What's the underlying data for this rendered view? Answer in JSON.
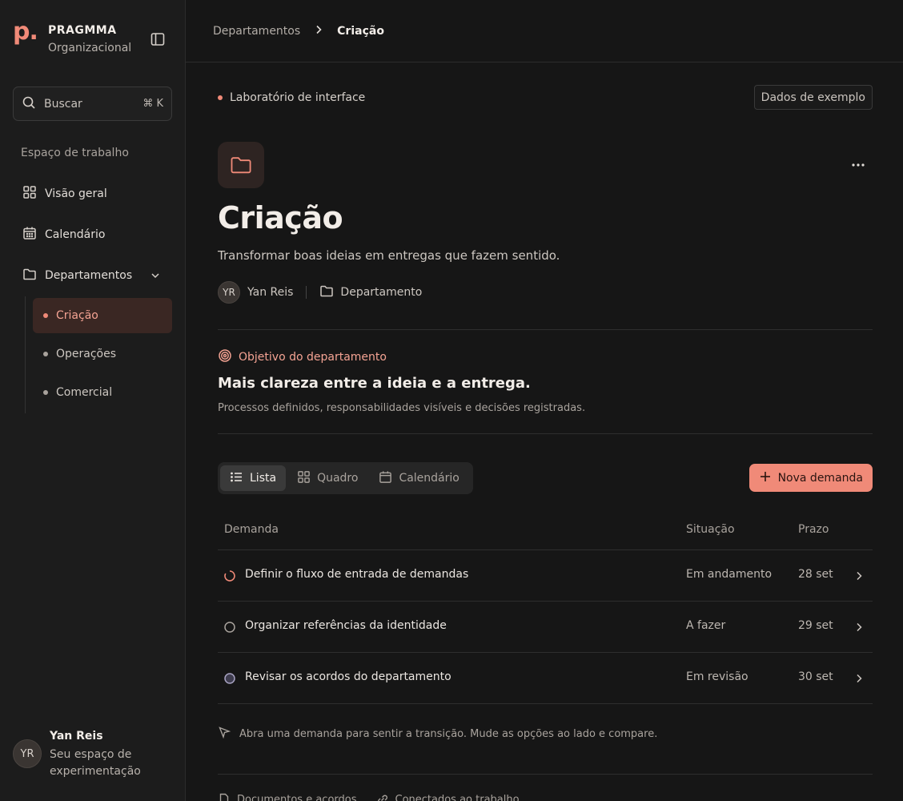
{
  "brand": {
    "logo": "p.",
    "name": "PRAGMMA",
    "subtitle": "Organizacional"
  },
  "search": {
    "label": "Buscar",
    "shortcut": "⌘ K"
  },
  "sidebar": {
    "section_label": "Espaço de trabalho",
    "items": [
      {
        "label": "Visão geral",
        "icon": "grid-icon"
      },
      {
        "label": "Calendário",
        "icon": "calendar-icon"
      },
      {
        "label": "Departamentos",
        "icon": "folder-icon"
      }
    ],
    "departments": [
      {
        "label": "Criação",
        "active": true
      },
      {
        "label": "Operações",
        "active": false
      },
      {
        "label": "Comercial",
        "active": false
      }
    ]
  },
  "user": {
    "initials": "YR",
    "name": "Yan Reis",
    "subtitle": "Seu espaço de experimentação"
  },
  "breadcrumb": {
    "parent": "Departamentos",
    "current": "Criação"
  },
  "header": {
    "lab_tag": "Laboratório de interface",
    "sample_button": "Dados de exemplo"
  },
  "department": {
    "title": "Criação",
    "description": "Transformar boas ideias em entregas que fazem sentido.",
    "owner_initials": "YR",
    "owner_name": "Yan Reis",
    "type": "Departamento"
  },
  "goal": {
    "label": "Objetivo do departamento",
    "title": "Mais clareza entre a ideia e a entrega.",
    "description": "Processos definidos, responsabilidades visíveis e decisões registradas."
  },
  "views": {
    "list": "Lista",
    "board": "Quadro",
    "calendar": "Calendário"
  },
  "new_button": "Nova demanda",
  "table": {
    "headers": {
      "demand": "Demanda",
      "status": "Situação",
      "due": "Prazo"
    },
    "rows": [
      {
        "title": "Definir o fluxo de entrada de demandas",
        "status": "Em andamento",
        "due": "28 set"
      },
      {
        "title": "Organizar referências da identidade",
        "status": "A fazer",
        "due": "29 set"
      },
      {
        "title": "Revisar os acordos do departamento",
        "status": "Em revisão",
        "due": "30 set"
      }
    ]
  },
  "hint": "Abra uma demanda para sentir a transição. Mude as opções ao lado e compare.",
  "footer": {
    "docs": "Documentos e acordos",
    "connected": "Conectados ao trabalho"
  },
  "colors": {
    "accent": "#f08a78",
    "background": "#161616",
    "sidebar": "#1c1c1c"
  }
}
